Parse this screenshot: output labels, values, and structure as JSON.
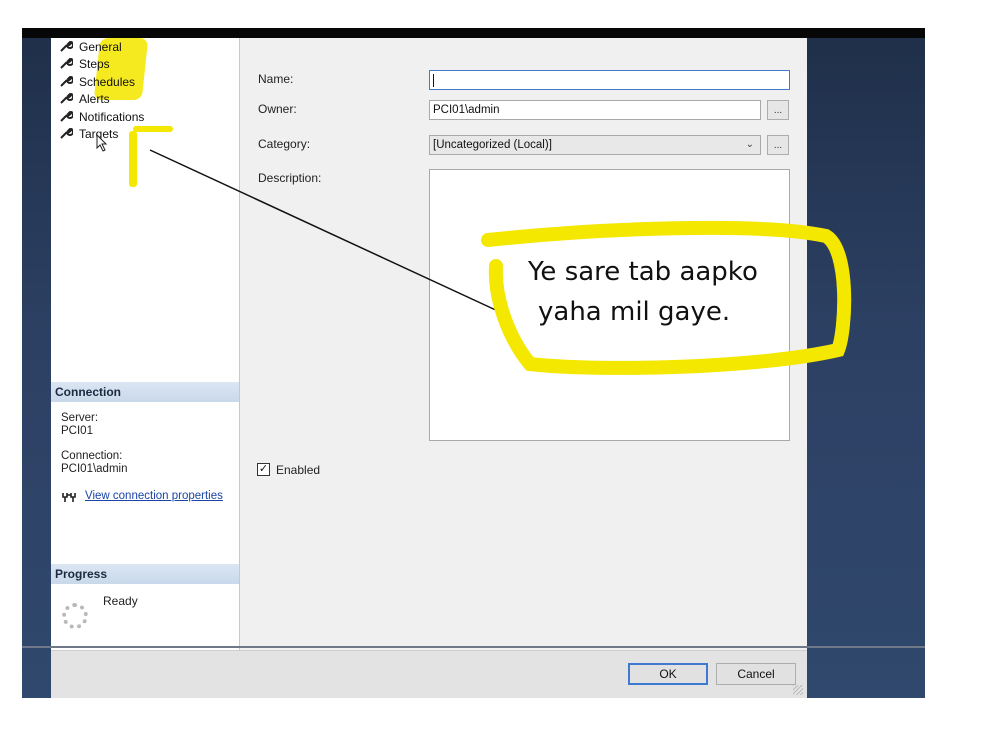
{
  "left_nav": {
    "items": [
      {
        "label": "General"
      },
      {
        "label": "Steps"
      },
      {
        "label": "Schedules"
      },
      {
        "label": "Alerts"
      },
      {
        "label": "Notifications"
      },
      {
        "label": "Targets"
      }
    ]
  },
  "connection": {
    "header": "Connection",
    "server_label": "Server:",
    "server_value": "PCI01",
    "connection_label": "Connection:",
    "connection_value": "PCI01\\admin",
    "link": "View connection properties"
  },
  "progress": {
    "header": "Progress",
    "status": "Ready"
  },
  "form": {
    "name_label": "Name:",
    "name_value": "",
    "owner_label": "Owner:",
    "owner_value": "PCI01\\admin",
    "category_label": "Category:",
    "category_value": "[Uncategorized (Local)]",
    "description_label": "Description:",
    "description_value": "",
    "ellipsis": "...",
    "enabled_label": "Enabled",
    "enabled_checked": true
  },
  "footer": {
    "ok": "OK",
    "cancel": "Cancel"
  },
  "annotation": {
    "line1": "Ye sare tab aapko",
    "line2": "yaha mil gaye."
  },
  "colors": {
    "highlight": "#f4e700",
    "link": "#1a44a8",
    "background": "#2c4063"
  }
}
